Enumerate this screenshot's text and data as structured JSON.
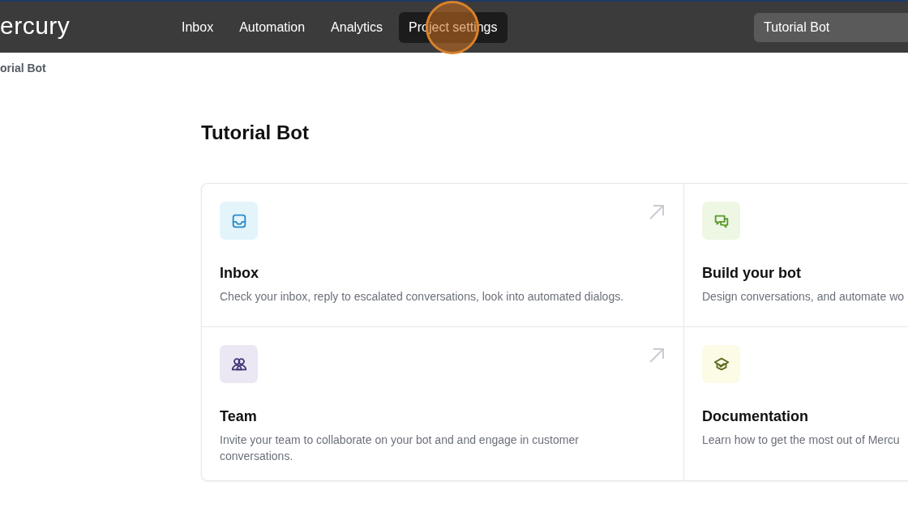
{
  "header": {
    "logo": "ercury",
    "nav": [
      {
        "label": "Inbox",
        "selected": false
      },
      {
        "label": "Automation",
        "selected": false
      },
      {
        "label": "Analytics",
        "selected": false
      },
      {
        "label": "Project settings",
        "selected": true
      }
    ],
    "project_field": {
      "value": "Tutorial Bot"
    }
  },
  "breadcrumb": "orial Bot",
  "title": "Tutorial Bot",
  "cards": [
    {
      "kind": "inbox",
      "title": "Inbox",
      "description": "Check your inbox, reply to escalated conversations, look into automated dialogs.",
      "external": true
    },
    {
      "kind": "chat",
      "title": "Build your bot",
      "description": "Design conversations, and automate wo"
    },
    {
      "kind": "team",
      "title": "Team",
      "description": "Invite your team to collaborate on your bot and and engage in customer conversations.",
      "external": true
    },
    {
      "kind": "docs",
      "title": "Documentation",
      "description": "Learn how to get the most out of Mercu"
    }
  ]
}
